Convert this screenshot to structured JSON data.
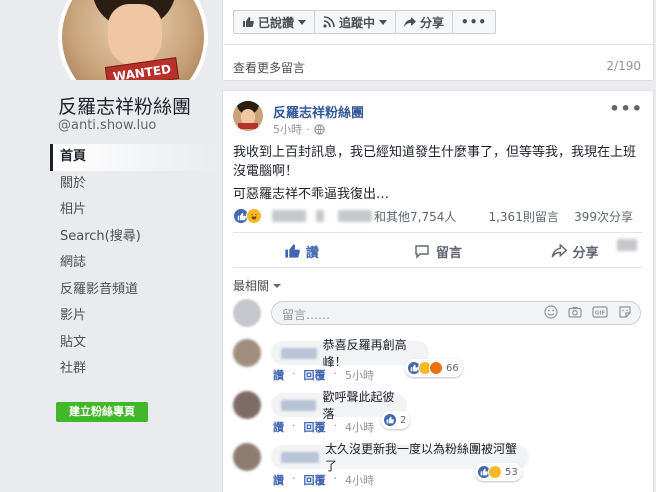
{
  "sidebar": {
    "page_name": "反羅志祥粉絲團",
    "handle": "@anti.show.luo",
    "avatar_badge": "WANTED",
    "nav": [
      "首頁",
      "關於",
      "相片",
      "Search(搜尋)",
      "網誌",
      "反羅影音頻道",
      "影片",
      "貼文",
      "社群"
    ],
    "create_button": "建立粉絲專頁"
  },
  "top_card": {
    "liked": "已說讚",
    "following": "追蹤中",
    "share": "分享",
    "more_comments": "查看更多留言",
    "comment_count": "2/190"
  },
  "post": {
    "author": "反羅志祥粉絲團",
    "time": "5小時",
    "text_line1": "我收到上百封訊息，我已經知道發生什麼事了，但等等我，我現在上班沒電腦啊！",
    "text_line2": "可惡羅志祥不乖逼我復出…",
    "reactions_text": "和其他7,754人",
    "comments_count": "1,361則留言",
    "shares_count": "399次分享",
    "actions": {
      "like": "讚",
      "comment": "留言",
      "share": "分享"
    },
    "sort_label": "最相關",
    "comment_placeholder": "留言……"
  },
  "comments": [
    {
      "text": "恭喜反羅再創高峰！",
      "like": "讚",
      "reply": "回覆",
      "time": "5小時",
      "reactions": "66"
    },
    {
      "text": "歡呼聲此起彼落",
      "like": "讚",
      "reply": "回覆",
      "time": "4小時",
      "reactions": "2"
    },
    {
      "text": "太久沒更新我一度以為粉絲團被河蟹了",
      "like": "讚",
      "reply": "回覆",
      "time": "4小時",
      "reactions": "53"
    }
  ],
  "colors": {
    "link": "#365899",
    "like_blue": "#4267b2",
    "green": "#42b72a",
    "bg": "#e9ebee"
  }
}
